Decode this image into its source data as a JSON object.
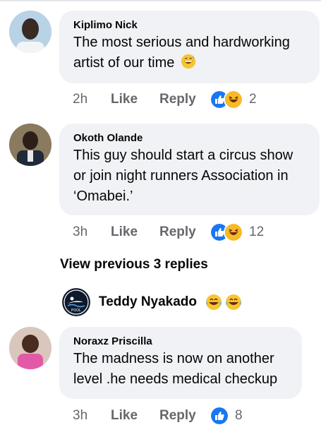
{
  "comments": [
    {
      "author": "Kiplimo Nick",
      "line1": "The most serious and hardworking",
      "line2": "artist of our time",
      "emoji": "grinning-sweat-emoji",
      "time": "2h",
      "like_label": "Like",
      "reply_label": "Reply",
      "reactions": [
        "like",
        "haha"
      ],
      "reaction_count": "2"
    },
    {
      "author": "Okoth Olande",
      "line1": "This guy should start a circus show",
      "line2": "or join night runners Association in",
      "line3": "‘Omabei.’",
      "time": "3h",
      "like_label": "Like",
      "reply_label": "Reply",
      "reactions": [
        "like",
        "haha"
      ],
      "reaction_count": "12"
    },
    {
      "author": "Noraxz Priscilla",
      "line1": "The madness is now on another",
      "line2": "level .he needs medical checkup",
      "time": "3h",
      "like_label": "Like",
      "reply_label": "Reply",
      "reactions": [
        "like"
      ],
      "reaction_count": "8"
    }
  ],
  "view_previous": "View previous 3 replies",
  "reply_preview": {
    "author": "Teddy Nyakado",
    "avatar_text": "POOL",
    "emojis": [
      "tears-of-joy-emoji",
      "tears-of-joy-emoji"
    ]
  },
  "colors": {
    "bubble": "#f0f2f5",
    "meta_text": "#65676b",
    "like_blue": "#1877f2",
    "haha_yellow": "#f7b928"
  }
}
